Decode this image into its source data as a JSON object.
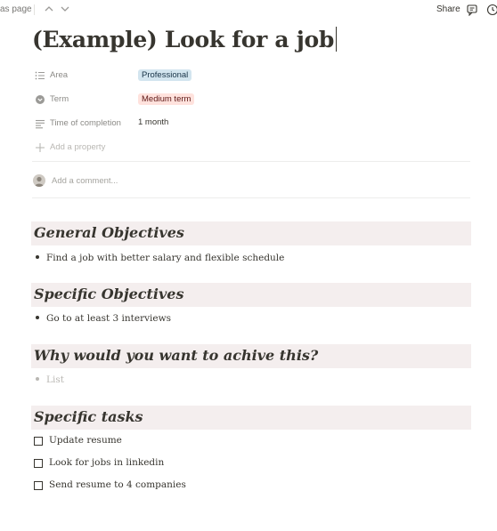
{
  "topbar": {
    "breadcrumb": "as page",
    "share_label": "Share"
  },
  "page": {
    "title": "(Example) Look for a job"
  },
  "properties": [
    {
      "icon": "list-icon",
      "name": "Area",
      "value": "Professional",
      "style": "tag-blue"
    },
    {
      "icon": "status-icon",
      "name": "Term",
      "value": "Medium term",
      "style": "tag-red"
    },
    {
      "icon": "text-icon",
      "name": "Time of completion",
      "value": "1 month",
      "style": "plain"
    }
  ],
  "add_property_label": "Add a property",
  "comment_placeholder": "Add a comment...",
  "sections": [
    {
      "heading": "General Objectives",
      "bullets": [
        "Find a job with better salary and flexible schedule"
      ]
    },
    {
      "heading": "Specific Objectives",
      "bullets": [
        "Go to at least 3 interviews"
      ]
    },
    {
      "heading": "Why would  you want to achive this?",
      "bullets": [
        "List"
      ],
      "placeholder": true
    },
    {
      "heading": "Specific tasks",
      "todos": [
        "Update resume",
        "Look for jobs in linkedin",
        "Send resume to 4 companies"
      ]
    }
  ],
  "colors": {
    "tag_blue_bg": "#d3e5ef",
    "tag_red_bg": "#ffe2dd",
    "heading_bg": "#f4eeee",
    "text": "#37352f",
    "muted": "#8b8a86"
  }
}
